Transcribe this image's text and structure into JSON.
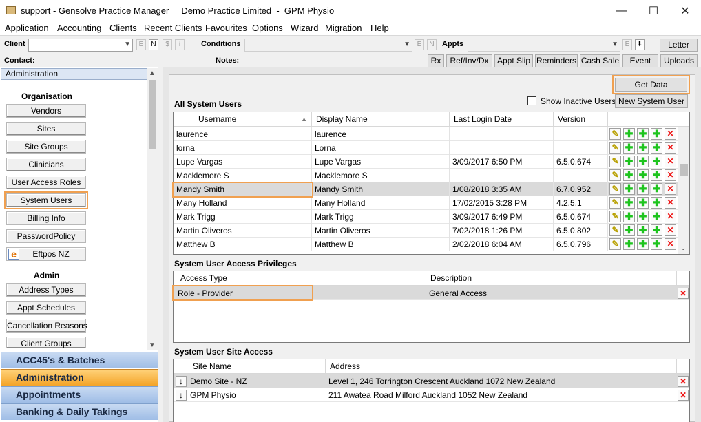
{
  "window": {
    "title": "support - Gensolve Practice Manager     Demo Practice Limited  -  GPM Physio",
    "min": "—",
    "max": "☐",
    "close": "✕"
  },
  "menu": [
    "Application",
    "Accounting",
    "Clients",
    "Recent Clients",
    "Favourites",
    "Options",
    "Wizard",
    "Migration",
    "Help"
  ],
  "toolbar": {
    "client_label": "Client",
    "contact_label": "Contact:",
    "conditions_label": "Conditions",
    "notes_label": "Notes:",
    "appts_label": "Appts",
    "e": "E",
    "n": "N",
    "dollar": "$",
    "i": "i",
    "letter": "Letter",
    "buttons": [
      "Rx",
      "Ref/Inv/Dx",
      "Appt Slip",
      "Reminders",
      "Cash Sale",
      "Event",
      "Uploads"
    ]
  },
  "left": {
    "header": "Administration",
    "sec_org": "Organisation",
    "org_items": [
      "Vendors",
      "Sites",
      "Site Groups",
      "Clinicians",
      "User Access Roles",
      "System Users",
      "Billing Info",
      "PasswordPolicy",
      "Eftpos NZ"
    ],
    "sec_admin": "Admin",
    "admin_items": [
      "Address Types",
      "Appt Schedules",
      "Cancellation Reasons",
      "Client Groups"
    ],
    "nav": [
      "ACC45's & Batches",
      "Administration",
      "Appointments",
      "Banking & Daily Takings"
    ]
  },
  "main": {
    "get_data": "Get Data",
    "all_users_title": "All System Users",
    "show_inactive": "Show Inactive Users",
    "new_user": "New System User",
    "users_cols": [
      "Username",
      "Display Name",
      "Last Login Date",
      "Version"
    ],
    "users": [
      {
        "u": "laurence",
        "d": "laurence",
        "l": "",
        "v": ""
      },
      {
        "u": "lorna",
        "d": "Lorna",
        "l": "",
        "v": ""
      },
      {
        "u": "Lupe Vargas",
        "d": "Lupe Vargas",
        "l": "3/09/2017 6:50 PM",
        "v": "6.5.0.674"
      },
      {
        "u": "Macklemore S",
        "d": "Macklemore S",
        "l": "",
        "v": ""
      },
      {
        "u": "Mandy Smith",
        "d": "Mandy Smith",
        "l": "1/08/2018 3:35 AM",
        "v": "6.7.0.952"
      },
      {
        "u": "Many Holland",
        "d": "Many Holland",
        "l": "17/02/2015 3:28 PM",
        "v": "4.2.5.1"
      },
      {
        "u": "Mark Trigg",
        "d": "Mark Trigg",
        "l": "3/09/2017 6:49 PM",
        "v": "6.5.0.674"
      },
      {
        "u": "Martin Oliveros",
        "d": "Martin Oliveros",
        "l": "7/02/2018 1:26 PM",
        "v": "6.5.0.802"
      },
      {
        "u": "Matthew B",
        "d": "Matthew B",
        "l": "2/02/2018 6:04 AM",
        "v": "6.5.0.796"
      }
    ],
    "priv_title": "System User Access Privileges",
    "priv_cols": [
      "Access Type",
      "Description"
    ],
    "priv_rows": [
      {
        "t": "Role - Provider",
        "d": "General Access"
      }
    ],
    "site_title": "System User Site Access",
    "site_cols": [
      "Site Name",
      "Address"
    ],
    "site_rows": [
      {
        "n": "Demo Site - NZ",
        "a": "Level 1, 246 Torrington Crescent Auckland  1072 New Zealand"
      },
      {
        "n": "GPM Physio",
        "a": "211 Awatea Road Milford Auckland  1052 New Zealand"
      }
    ]
  },
  "colors": {
    "highlight": "#f0a050",
    "nav_active": "#f4a428",
    "nav": "#9fbde6"
  }
}
